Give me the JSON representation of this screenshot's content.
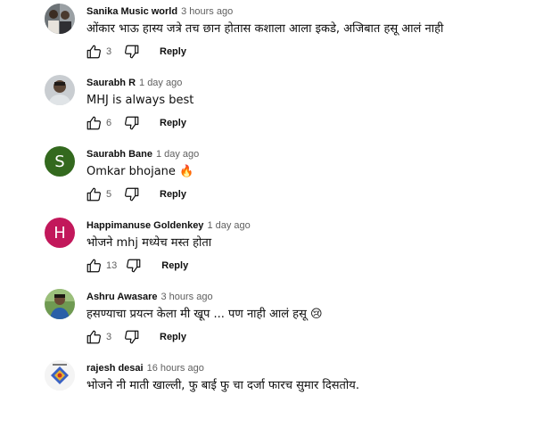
{
  "comments": [
    {
      "author": "Sanika Music world",
      "time": "3 hours ago",
      "text": "ओंकार भाऊ हास्य जत्रे तच छान होतास कशाला आला इकडे, अजिबात हसू आलं नाही",
      "likes": "3",
      "reply_label": "Reply",
      "avatar": {
        "kind": "photo",
        "bg": "#8a8f94"
      }
    },
    {
      "author": "Saurabh R",
      "time": "1 day ago",
      "text": "MHJ is always best",
      "likes": "6",
      "reply_label": "Reply",
      "avatar": {
        "kind": "photo",
        "bg": "#b8bcc0"
      }
    },
    {
      "author": "Saurabh Bane",
      "time": "1 day ago",
      "text": "Omkar bhojane 🔥",
      "likes": "5",
      "reply_label": "Reply",
      "avatar": {
        "kind": "letter",
        "letter": "S",
        "bg": "#33691e"
      }
    },
    {
      "author": "Happimanuse Goldenkey",
      "time": "1 day ago",
      "text": "भोजने mhj मध्येच मस्त होता",
      "likes": "13",
      "reply_label": "Reply",
      "avatar": {
        "kind": "letter",
        "letter": "H",
        "bg": "#c2185b"
      }
    },
    {
      "author": "Ashru Awasare",
      "time": "3 hours ago",
      "text": "हसण्याचा प्रयत्न केला मी खूप ... पण नाही आलं हसू 😢",
      "likes": "3",
      "reply_label": "Reply",
      "avatar": {
        "kind": "photo",
        "bg": "#3f7a3a"
      }
    },
    {
      "author": "rajesh desai",
      "time": "16 hours ago",
      "text": "भोजने नी माती खाल्ली, फु बाई फु चा दर्जा फारच सुमार दिसतोय.",
      "likes": "",
      "reply_label": "",
      "avatar": {
        "kind": "logo",
        "bg": "#f4f4f4"
      }
    }
  ]
}
